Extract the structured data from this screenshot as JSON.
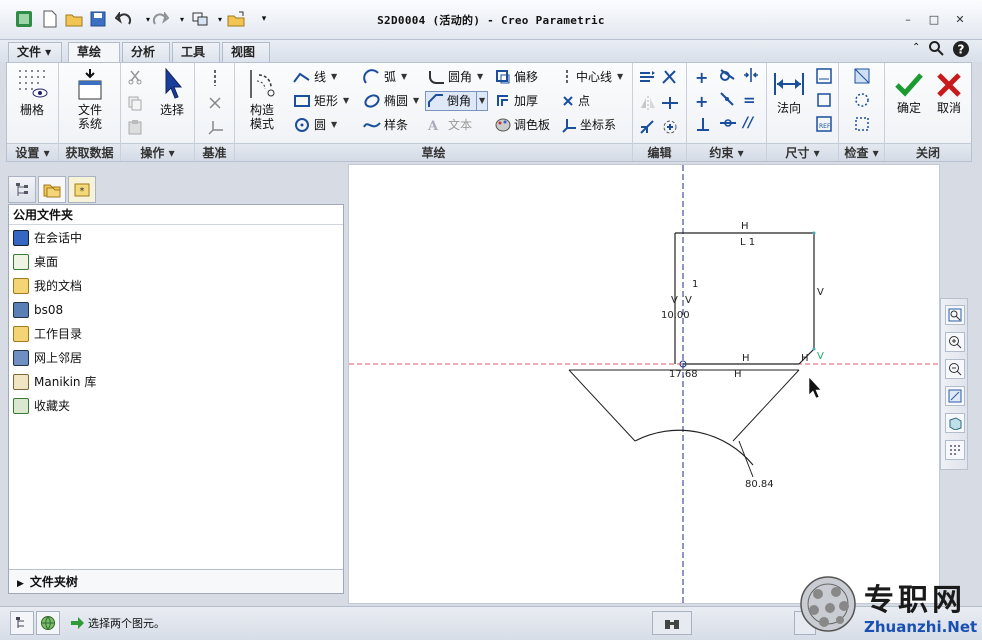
{
  "window": {
    "title": "S2D0004 (活动的) - Creo Parametric",
    "min": "–",
    "max": "□",
    "close": "✕"
  },
  "tabs": [
    {
      "label": "文件 ▾"
    },
    {
      "label": "草绘"
    },
    {
      "label": "分析"
    },
    {
      "label": "工具"
    },
    {
      "label": "视图"
    }
  ],
  "ribbon": {
    "groups": {
      "settings": "设置 ▾",
      "get_data": "获取数据",
      "operations": "操作 ▾",
      "datum": "基准",
      "sketch": "草绘",
      "edit": "编辑",
      "constrain": "约束 ▾",
      "dimension": "尺寸 ▾",
      "inspect": "检查 ▾",
      "close": "关闭"
    },
    "grid_label": "栅格",
    "file_system_label": "文件\n系统",
    "file_system_l1": "文件",
    "file_system_l2": "系统",
    "select_label": "选择",
    "construct_l1": "构造",
    "construct_l2": "模式",
    "sketch_tools": {
      "line": "线",
      "arc": "弧",
      "fillet": "圆角",
      "offset": "偏移",
      "centerline": "中心线",
      "rectangle": "矩形",
      "ellipse": "椭圆",
      "chamfer": "倒角",
      "thicken": "加厚",
      "point": "点",
      "circle": "圆",
      "spline": "样条",
      "text": "文本",
      "palette": "调色板",
      "coordsys": "坐标系"
    },
    "normal_label": "法向",
    "ok_label": "确定",
    "cancel_label": "取消"
  },
  "sidebar": {
    "header": "公用文件夹",
    "items": [
      {
        "label": "在会话中"
      },
      {
        "label": "桌面"
      },
      {
        "label": "我的文档"
      },
      {
        "label": "bs08"
      },
      {
        "label": "工作目录"
      },
      {
        "label": "网上邻居"
      },
      {
        "label": "Manikin 库"
      },
      {
        "label": "收藏夹"
      }
    ],
    "folder_tree": "文件夹树"
  },
  "sketch": {
    "dim_height": "10.00",
    "dim_width": "17.68",
    "dim_radius": "80.84",
    "c_h": "H",
    "c_v": "V",
    "c_l1": "L 1",
    "c_1": "1"
  },
  "status": {
    "message": "选择两个图元。"
  },
  "watermark": {
    "text": "专职网",
    "url": "Zhuanzhi.Net"
  },
  "colors": {
    "accent": "#1b4f9c",
    "ok_green": "#1a9b2f",
    "cancel_red": "#c8191c",
    "sketch_line": "#222222",
    "centerline_blue": "#1d2f8a",
    "ref_line_red": "#e05a6a"
  }
}
